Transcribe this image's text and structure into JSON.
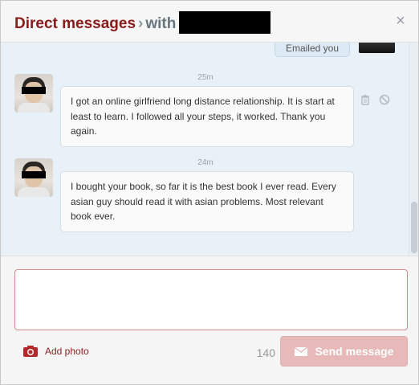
{
  "header": {
    "title": "Direct messages",
    "separator": "›",
    "with_label": "with",
    "close_label": "×"
  },
  "conversation": {
    "sent_message": "Emailed you",
    "messages": [
      {
        "time": "25m",
        "text": "I got an online girlfriend long distance relationship. It is start at least to learn. I followed all your steps, it worked. Thank you again."
      },
      {
        "time": "24m",
        "text": "I bought your book, so far it is the best book I ever read. Every asian guy should read it with asian problems. Most relevant book ever."
      }
    ]
  },
  "composer": {
    "text_value": "",
    "add_photo_label": "Add photo",
    "char_count": "140",
    "send_label": "Send message"
  },
  "colors": {
    "brand_red": "#8b1a1a",
    "send_disabled": "#e8b9b9",
    "conversation_bg": "#e9f1f8"
  }
}
